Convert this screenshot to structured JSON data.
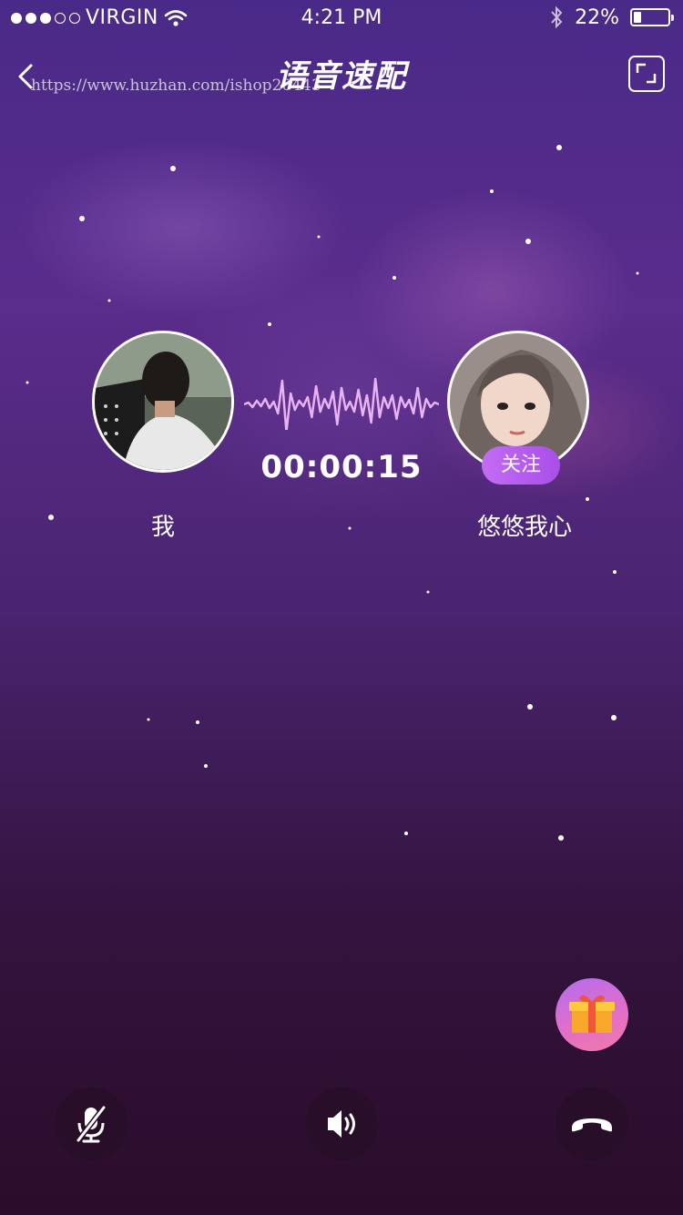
{
  "status_bar": {
    "carrier": "VIRGIN",
    "time": "4:21 PM",
    "battery": "22%",
    "battery_level": 0.22,
    "signal_bars_filled": 3,
    "signal_bars_total": 5
  },
  "nav": {
    "title": "语音速配",
    "watermark": "https://www.huzhan.com/ishop20443"
  },
  "call": {
    "me": {
      "name": "我"
    },
    "peer": {
      "name": "悠悠我心",
      "follow_label": "关注"
    },
    "timer": "00:00:15"
  },
  "icons": {
    "back": "chevron-left-icon",
    "expand": "expand-icon",
    "gift": "gift-icon",
    "mic": "mic-muted-icon",
    "speaker": "speaker-icon",
    "hangup": "hangup-icon"
  },
  "colors": {
    "follow_button": "#b25cf0",
    "waveform": "#e9b3f5",
    "control_bg": "#2a0e28"
  }
}
